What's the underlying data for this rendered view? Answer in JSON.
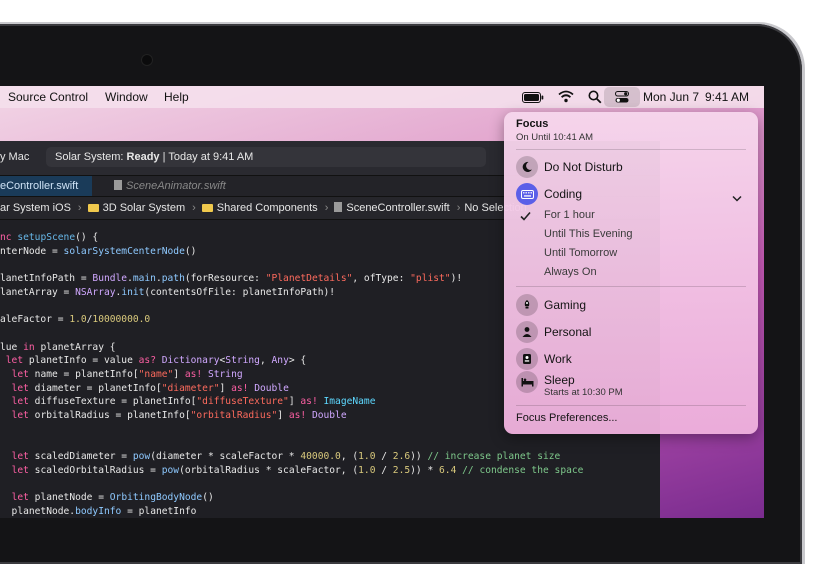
{
  "menubar": {
    "items": [
      "Source Control",
      "Window",
      "Help"
    ],
    "date": "Mon Jun 7",
    "time": "9:41 AM",
    "icons": [
      "battery-icon",
      "wifi-icon",
      "search-icon",
      "control-center-icon"
    ]
  },
  "xcode": {
    "scheme": "y Mac",
    "status_prefix": "Solar System: ",
    "status_bold": "Ready",
    "status_suffix": " | Today at 9:41 AM",
    "tabs": [
      {
        "label": "eController.swift",
        "active": true
      },
      {
        "label": "SceneAnimator.swift",
        "active": false
      }
    ],
    "breadcrumb": [
      "ar System iOS",
      "3D Solar System",
      "Shared Components",
      "SceneController.swift",
      "No Selection"
    ]
  },
  "focus": {
    "title": "Focus",
    "subtitle": "On Until 10:41 AM",
    "do_not_disturb": "Do Not Disturb",
    "coding": "Coding",
    "options": [
      "For 1 hour",
      "Until This Evening",
      "Until Tomorrow",
      "Always On"
    ],
    "selected_option": "For 1 hour",
    "gaming": "Gaming",
    "personal": "Personal",
    "work": "Work",
    "sleep": "Sleep",
    "sleep_sub": "Starts at 10:30 PM",
    "preferences": "Focus Preferences..."
  }
}
